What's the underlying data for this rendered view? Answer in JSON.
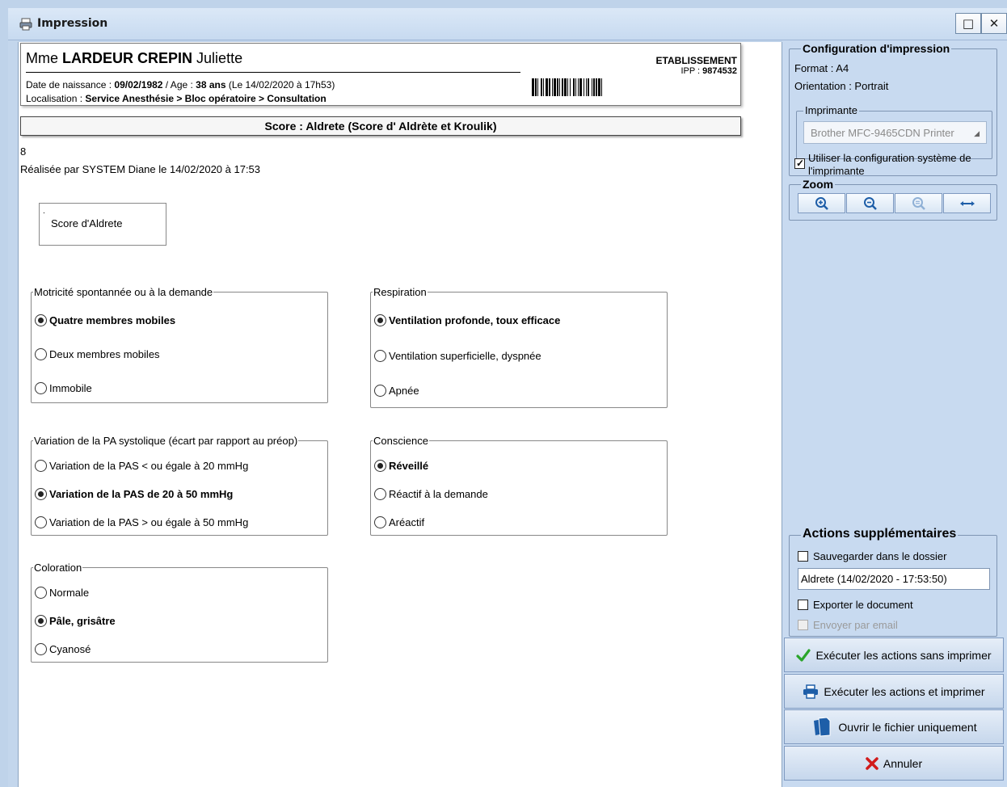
{
  "window": {
    "title": "Impression",
    "maximize_label": "□",
    "close_label": "✕"
  },
  "patient": {
    "civility": "Mme",
    "last_name": "LARDEUR CREPIN",
    "first_name": "Juliette",
    "birth_label": "Date de naissance : ",
    "birth_date": "09/02/1982",
    "age_label": " / Age : ",
    "age": "38 ans",
    "age_date": " (Le 14/02/2020 à 17h53)",
    "loc_label": "Localisation : ",
    "location": "Service Anesthésie > Bloc opératoire > Consultation",
    "establishment": "ETABLISSEMENT",
    "ipp_label": "IPP : ",
    "ipp": "9874532"
  },
  "score": {
    "title": "Score : Aldrete (Score d' Aldrète et Kroulik)",
    "value": "8",
    "byline": "Réalisée par SYSTEM Diane le 14/02/2020 à 17:53",
    "box_dot": ".",
    "box_label": "Score d'Aldrete"
  },
  "groups": {
    "motricite": {
      "legend": "Motricité spontannée ou à la demande",
      "options": [
        "Quatre membres mobiles",
        "Deux membres mobiles",
        "Immobile"
      ],
      "selected": 0
    },
    "respiration": {
      "legend": "Respiration",
      "options": [
        "Ventilation profonde, toux efficace",
        "Ventilation superficielle, dyspnée",
        "Apnée"
      ],
      "selected": 0
    },
    "pa": {
      "legend": "Variation de la PA systolique (écart par rapport au préop)",
      "options": [
        "Variation de la PAS < ou égale à 20 mmHg",
        "Variation de la PAS de 20 à 50 mmHg",
        "Variation de la PAS > ou égale à 50 mmHg"
      ],
      "selected": 1
    },
    "conscience": {
      "legend": "Conscience",
      "options": [
        "Réveillé",
        "Réactif à la demande",
        "Aréactif"
      ],
      "selected": 0
    },
    "coloration": {
      "legend": "Coloration",
      "options": [
        "Normale",
        "Pâle, grisâtre",
        "Cyanosé"
      ],
      "selected": 1
    }
  },
  "config": {
    "title": "Configuration d'impression",
    "format": "Format : A4",
    "orientation": "Orientation : Portrait",
    "printer_group": "Imprimante",
    "printer": "Brother MFC-9465CDN Printer",
    "system_config": "Utiliser la configuration système de l'imprimante",
    "system_config_checked": true
  },
  "zoom": {
    "title": "Zoom",
    "buttons": [
      "zoom-in-icon",
      "zoom-out-icon",
      "zoom-reset-icon",
      "fit-width-icon"
    ]
  },
  "actions": {
    "title": "Actions supplémentaires",
    "save_label": "Sauvegarder dans le dossier",
    "save_checked": false,
    "filename": "Aldrete (14/02/2020 - 17:53:50)",
    "export_label": "Exporter le document",
    "export_checked": false,
    "email_label": "Envoyer par email",
    "email_disabled": true
  },
  "buttons": {
    "run_no_print": "Exécuter les actions sans imprimer",
    "run_print": "Exécuter les actions et imprimer",
    "open_file": "Ouvrir le fichier uniquement",
    "cancel": "Annuler"
  },
  "colors": {
    "check_green": "#2aa52a",
    "cancel_red": "#d11b1b",
    "icon_blue": "#1e5ea8"
  }
}
